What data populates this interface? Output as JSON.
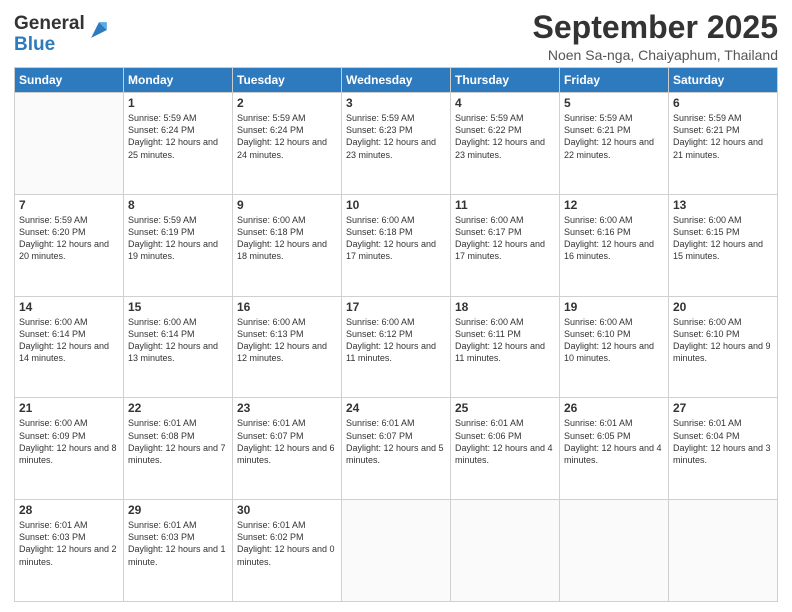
{
  "logo": {
    "general": "General",
    "blue": "Blue"
  },
  "header": {
    "title": "September 2025",
    "subtitle": "Noen Sa-nga, Chaiyaphum, Thailand"
  },
  "weekdays": [
    "Sunday",
    "Monday",
    "Tuesday",
    "Wednesday",
    "Thursday",
    "Friday",
    "Saturday"
  ],
  "weeks": [
    [
      {
        "day": null
      },
      {
        "day": "1",
        "sunrise": "5:59 AM",
        "sunset": "6:24 PM",
        "daylight": "12 hours and 25 minutes."
      },
      {
        "day": "2",
        "sunrise": "5:59 AM",
        "sunset": "6:24 PM",
        "daylight": "12 hours and 24 minutes."
      },
      {
        "day": "3",
        "sunrise": "5:59 AM",
        "sunset": "6:23 PM",
        "daylight": "12 hours and 23 minutes."
      },
      {
        "day": "4",
        "sunrise": "5:59 AM",
        "sunset": "6:22 PM",
        "daylight": "12 hours and 23 minutes."
      },
      {
        "day": "5",
        "sunrise": "5:59 AM",
        "sunset": "6:21 PM",
        "daylight": "12 hours and 22 minutes."
      },
      {
        "day": "6",
        "sunrise": "5:59 AM",
        "sunset": "6:21 PM",
        "daylight": "12 hours and 21 minutes."
      }
    ],
    [
      {
        "day": "7",
        "sunrise": "5:59 AM",
        "sunset": "6:20 PM",
        "daylight": "12 hours and 20 minutes."
      },
      {
        "day": "8",
        "sunrise": "5:59 AM",
        "sunset": "6:19 PM",
        "daylight": "12 hours and 19 minutes."
      },
      {
        "day": "9",
        "sunrise": "6:00 AM",
        "sunset": "6:18 PM",
        "daylight": "12 hours and 18 minutes."
      },
      {
        "day": "10",
        "sunrise": "6:00 AM",
        "sunset": "6:18 PM",
        "daylight": "12 hours and 17 minutes."
      },
      {
        "day": "11",
        "sunrise": "6:00 AM",
        "sunset": "6:17 PM",
        "daylight": "12 hours and 17 minutes."
      },
      {
        "day": "12",
        "sunrise": "6:00 AM",
        "sunset": "6:16 PM",
        "daylight": "12 hours and 16 minutes."
      },
      {
        "day": "13",
        "sunrise": "6:00 AM",
        "sunset": "6:15 PM",
        "daylight": "12 hours and 15 minutes."
      }
    ],
    [
      {
        "day": "14",
        "sunrise": "6:00 AM",
        "sunset": "6:14 PM",
        "daylight": "12 hours and 14 minutes."
      },
      {
        "day": "15",
        "sunrise": "6:00 AM",
        "sunset": "6:14 PM",
        "daylight": "12 hours and 13 minutes."
      },
      {
        "day": "16",
        "sunrise": "6:00 AM",
        "sunset": "6:13 PM",
        "daylight": "12 hours and 12 minutes."
      },
      {
        "day": "17",
        "sunrise": "6:00 AM",
        "sunset": "6:12 PM",
        "daylight": "12 hours and 11 minutes."
      },
      {
        "day": "18",
        "sunrise": "6:00 AM",
        "sunset": "6:11 PM",
        "daylight": "12 hours and 11 minutes."
      },
      {
        "day": "19",
        "sunrise": "6:00 AM",
        "sunset": "6:10 PM",
        "daylight": "12 hours and 10 minutes."
      },
      {
        "day": "20",
        "sunrise": "6:00 AM",
        "sunset": "6:10 PM",
        "daylight": "12 hours and 9 minutes."
      }
    ],
    [
      {
        "day": "21",
        "sunrise": "6:00 AM",
        "sunset": "6:09 PM",
        "daylight": "12 hours and 8 minutes."
      },
      {
        "day": "22",
        "sunrise": "6:01 AM",
        "sunset": "6:08 PM",
        "daylight": "12 hours and 7 minutes."
      },
      {
        "day": "23",
        "sunrise": "6:01 AM",
        "sunset": "6:07 PM",
        "daylight": "12 hours and 6 minutes."
      },
      {
        "day": "24",
        "sunrise": "6:01 AM",
        "sunset": "6:07 PM",
        "daylight": "12 hours and 5 minutes."
      },
      {
        "day": "25",
        "sunrise": "6:01 AM",
        "sunset": "6:06 PM",
        "daylight": "12 hours and 4 minutes."
      },
      {
        "day": "26",
        "sunrise": "6:01 AM",
        "sunset": "6:05 PM",
        "daylight": "12 hours and 4 minutes."
      },
      {
        "day": "27",
        "sunrise": "6:01 AM",
        "sunset": "6:04 PM",
        "daylight": "12 hours and 3 minutes."
      }
    ],
    [
      {
        "day": "28",
        "sunrise": "6:01 AM",
        "sunset": "6:03 PM",
        "daylight": "12 hours and 2 minutes."
      },
      {
        "day": "29",
        "sunrise": "6:01 AM",
        "sunset": "6:03 PM",
        "daylight": "12 hours and 1 minute."
      },
      {
        "day": "30",
        "sunrise": "6:01 AM",
        "sunset": "6:02 PM",
        "daylight": "12 hours and 0 minutes."
      },
      {
        "day": null
      },
      {
        "day": null
      },
      {
        "day": null
      },
      {
        "day": null
      }
    ]
  ],
  "labels": {
    "sunrise": "Sunrise:",
    "sunset": "Sunset:",
    "daylight": "Daylight:"
  }
}
